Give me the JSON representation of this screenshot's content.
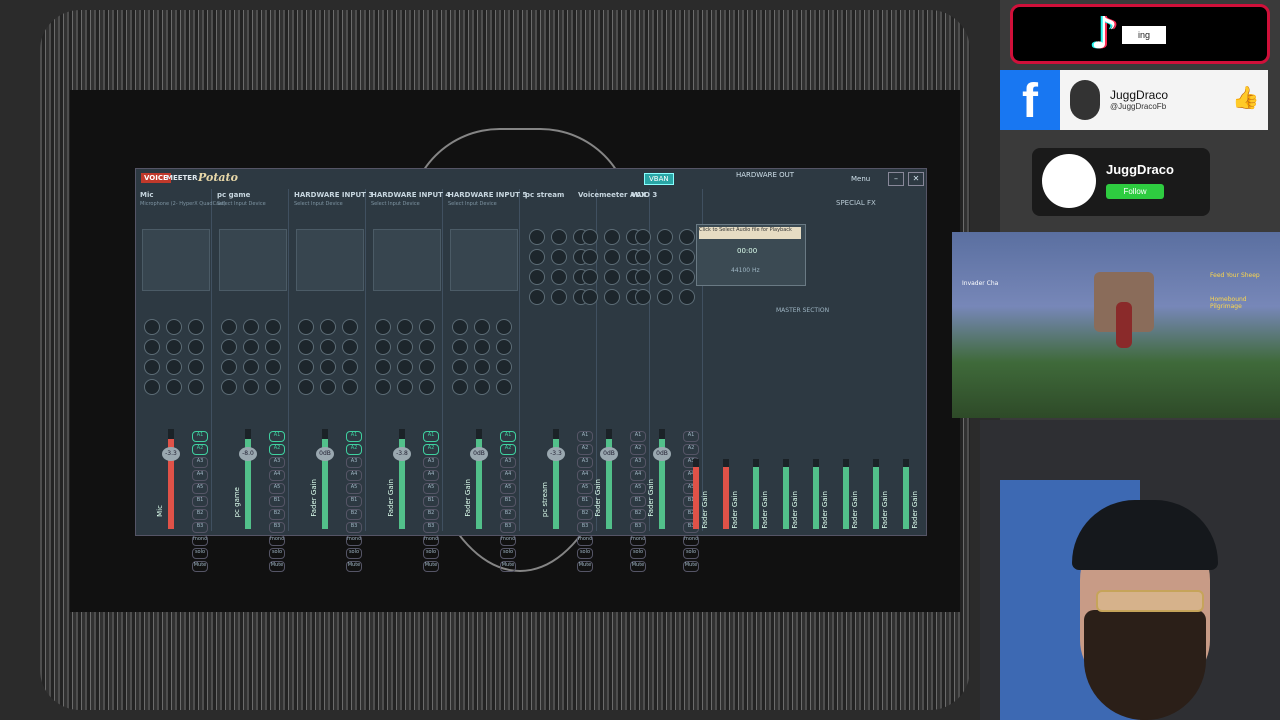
{
  "voicemeeter": {
    "brand_voice": "VOICE",
    "brand_meeter": "MEETER",
    "brand_potato": "Potato",
    "vban": "VBAN",
    "menu": "Menu",
    "hardware_out": "HARDWARE OUT",
    "special_fx": "SPECIAL FX",
    "master_section": "MASTER SECTION",
    "inputs": [
      {
        "title": "Mic",
        "sub": "Microphone (2- HyperX QuadCast)",
        "fader_label": "Mic",
        "level": "-3.3",
        "color": "#e05248"
      },
      {
        "title": "pc game",
        "sub": "Select Input Device",
        "fader_label": "pc game",
        "level": "-8.0",
        "color": "#52c08a"
      },
      {
        "title": "HARDWARE INPUT 3",
        "sub": "Select Input Device",
        "fader_label": "Fader Gain",
        "level": "0dB",
        "color": "#52c08a"
      },
      {
        "title": "HARDWARE INPUT 4",
        "sub": "Select Input Device",
        "fader_label": "Fader Gain",
        "level": "-3.8",
        "color": "#52c08a"
      },
      {
        "title": "HARDWARE INPUT 5",
        "sub": "Select Input Device",
        "fader_label": "Fader Gain",
        "level": "0dB",
        "color": "#52c08a"
      }
    ],
    "virtual": [
      {
        "title": "pc stream",
        "fader_label": "pc stream",
        "level": "-3.3"
      },
      {
        "title": "Voicemeeter AUX",
        "fader_label": "Fader Gain",
        "level": "0dB"
      },
      {
        "title": "VAIO 3",
        "fader_label": "Fader Gain",
        "level": "0dB"
      }
    ],
    "outputs": [
      "Fader Gain",
      "Fader Gain",
      "Fader Gain",
      "Fader Gain",
      "Fader Gain",
      "Fader Gain",
      "Fader Gain",
      "Fader Gain"
    ],
    "cassette_label": "Click to Select Audio file for Playback",
    "cassette_time": "00:00",
    "cassette_rate": "44100 Hz",
    "buttons_route": [
      "A1",
      "A2",
      "A3",
      "A4",
      "A5",
      "B1",
      "B2",
      "B3",
      "mono",
      "solo",
      "Mute"
    ]
  },
  "tiktok": {
    "text": "ing"
  },
  "facebook": {
    "name": "JuggDraco",
    "handle": "@JuggDracoFb"
  },
  "twitch": {
    "name": "JuggDraco",
    "follow": "Follow"
  },
  "game": {
    "quest_title": "Feed Your Sheep",
    "quest_2": "Homebound Pilgrimage",
    "hud_left": "Invader Cha"
  },
  "colors": {
    "accent_red": "#d0103a",
    "fb_blue": "#1877f2",
    "follow_green": "#2ecc40"
  }
}
